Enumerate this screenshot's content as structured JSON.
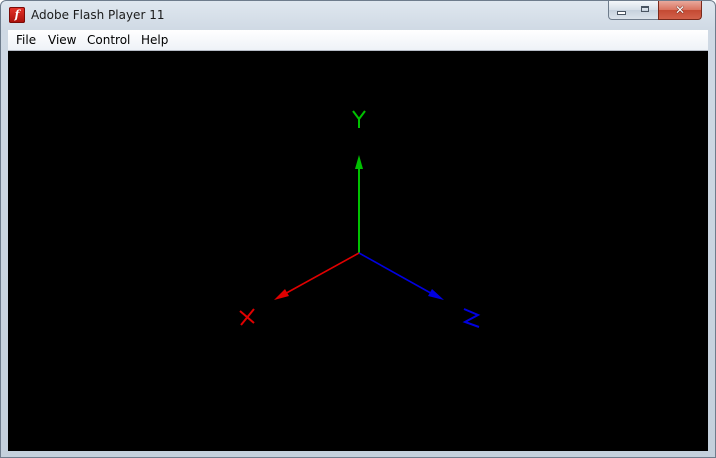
{
  "window": {
    "title": "Adobe Flash Player 11",
    "icon": "flash-player-icon",
    "icon_glyph": "f",
    "controls": {
      "minimize_icon": "minimize-icon",
      "maximize_icon": "maximize-icon",
      "close_icon": "close-icon",
      "close_glyph": "✕"
    }
  },
  "menubar": {
    "items": [
      {
        "label": "File"
      },
      {
        "label": "View"
      },
      {
        "label": "Control"
      },
      {
        "label": "Help"
      }
    ]
  },
  "stage": {
    "background": "#000000",
    "axes": [
      {
        "label": "Y",
        "color": "#00c000"
      },
      {
        "label": "X",
        "color": "#e00000"
      },
      {
        "label": "Z",
        "color": "#0000e0"
      }
    ]
  }
}
